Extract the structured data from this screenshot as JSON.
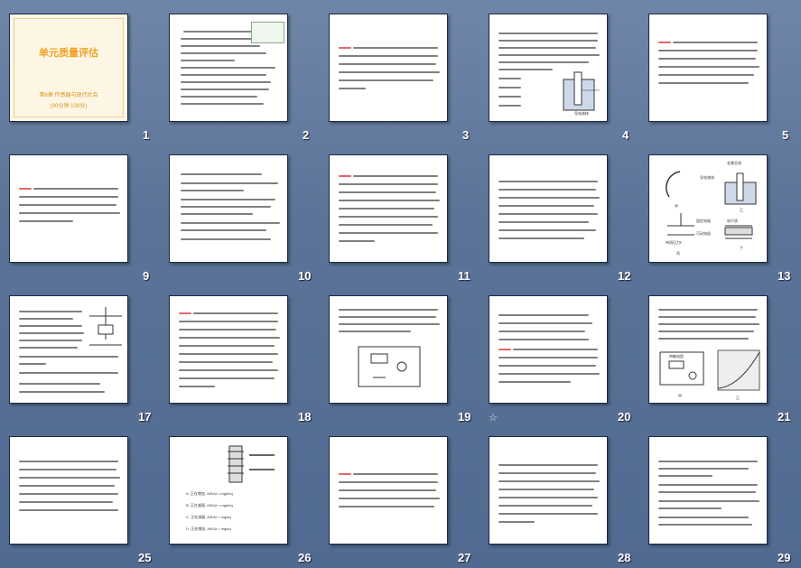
{
  "title_slide": {
    "title": "单元质量评估",
    "subtitle": "第6章 传感器与现代社会",
    "meta": "(90分钟 100分)"
  },
  "slides": [
    {
      "number": "1",
      "kind": "title"
    },
    {
      "number": "2",
      "kind": "text"
    },
    {
      "number": "3",
      "kind": "answer"
    },
    {
      "number": "4",
      "kind": "text-diagram"
    },
    {
      "number": "5",
      "kind": "answer"
    },
    {
      "number": "9",
      "kind": "answer"
    },
    {
      "number": "10",
      "kind": "text"
    },
    {
      "number": "11",
      "kind": "answer"
    },
    {
      "number": "12",
      "kind": "text"
    },
    {
      "number": "13",
      "kind": "diagram"
    },
    {
      "number": "17",
      "kind": "text-diagram"
    },
    {
      "number": "18",
      "kind": "answer"
    },
    {
      "number": "19",
      "kind": "text-diagram"
    },
    {
      "number": "20",
      "kind": "text"
    },
    {
      "number": "21",
      "kind": "text-chart"
    },
    {
      "number": "25",
      "kind": "text"
    },
    {
      "number": "26",
      "kind": "diagram"
    },
    {
      "number": "27",
      "kind": "answer"
    },
    {
      "number": "28",
      "kind": "text"
    },
    {
      "number": "29",
      "kind": "text"
    }
  ],
  "diagram_labels": {
    "gauge": "导电液体",
    "s13_a": "金属芯线",
    "s13_b": "导电液体",
    "s13_c": "固定电极",
    "s13_d": "可动电极",
    "s13_e": "电介质",
    "s13_f": "待测压力F",
    "s13_g": "甲",
    "s13_h": "乙",
    "s13_i": "丙",
    "s13_j": "丁",
    "s21_a": "甲",
    "s21_b": "乙",
    "s21_c": "热敏电阻",
    "s26_a": "A. 正在增加, ΔΦ/Δt = mgd/nq",
    "s26_b": "B. 正在减弱, ΔΦ/Δt = mgd/nq",
    "s26_c": "C. 正在减弱, ΔΦ/Δt = mgd/q",
    "s26_d": "D. 正在增加, ΔΦ/Δt = mgd/q"
  }
}
